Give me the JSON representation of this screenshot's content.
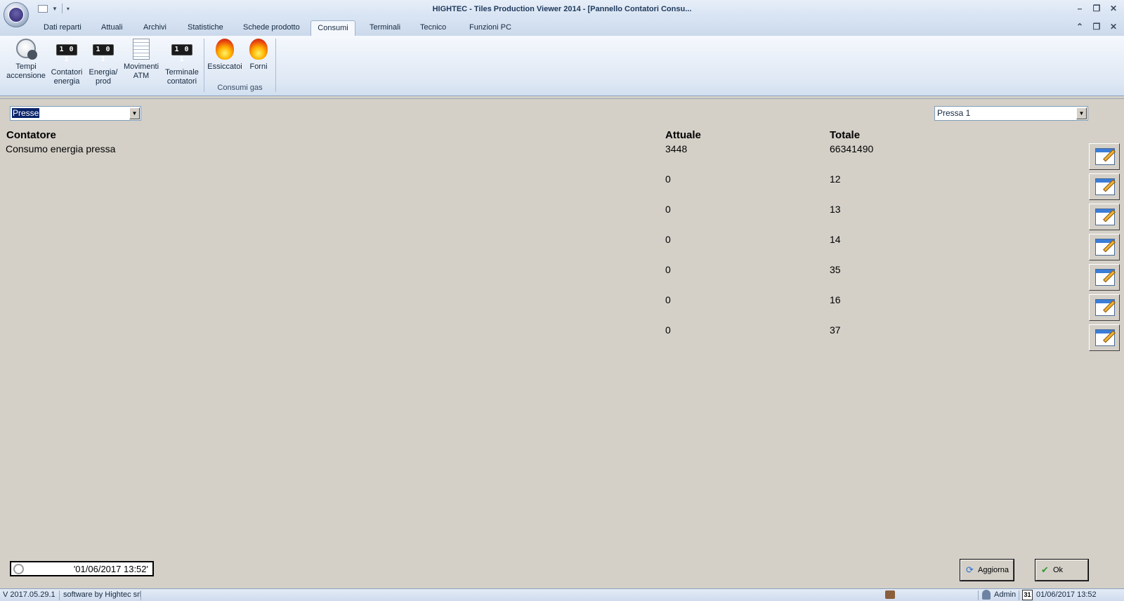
{
  "window": {
    "title": "HIGHTEC - Tiles Production Viewer 2014 - [Pannello Contatori Consu..."
  },
  "tabs": [
    {
      "label": "Dati reparti"
    },
    {
      "label": "Attuali"
    },
    {
      "label": "Archivi"
    },
    {
      "label": "Statistiche"
    },
    {
      "label": "Schede prodotto"
    },
    {
      "label": "Consumi"
    },
    {
      "label": "Terminali"
    },
    {
      "label": "Tecnico"
    },
    {
      "label": "Funzioni PC"
    }
  ],
  "active_tab": "Consumi",
  "ribbon": {
    "buttons": [
      {
        "label1": "Tempi",
        "label2": "accensione",
        "icon": "clock-icon"
      },
      {
        "label1": "Contatori",
        "label2": "energia",
        "icon": "counter-icon"
      },
      {
        "label1": "Energia/",
        "label2": "prod",
        "icon": "counter-icon"
      },
      {
        "label1": "Movimenti",
        "label2": "ATM",
        "icon": "sheet-icon"
      },
      {
        "label1": "Terminale",
        "label2": "contatori",
        "icon": "counter-icon"
      },
      {
        "label1": "Essiccatoi",
        "label2": "",
        "icon": "flame-icon"
      },
      {
        "label1": "Forni",
        "label2": "",
        "icon": "flame-icon"
      }
    ],
    "counter_glyph": "1 0 1",
    "group_label": "Consumi gas"
  },
  "filters": {
    "left_combo": "Presse",
    "right_combo": "Pressa 1"
  },
  "table": {
    "headers": {
      "contatore": "Contatore",
      "attuale": "Attuale",
      "totale": "Totale"
    },
    "rows": [
      {
        "contatore": "Consumo energia pressa",
        "attuale": "3448",
        "totale": "66341490"
      },
      {
        "contatore": "",
        "attuale": "0",
        "totale": "12"
      },
      {
        "contatore": "",
        "attuale": "0",
        "totale": "13"
      },
      {
        "contatore": "",
        "attuale": "0",
        "totale": "14"
      },
      {
        "contatore": "",
        "attuale": "0",
        "totale": "35"
      },
      {
        "contatore": "",
        "attuale": "0",
        "totale": "16"
      },
      {
        "contatore": "",
        "attuale": "0",
        "totale": "37"
      }
    ]
  },
  "footer": {
    "datetime_field": "'01/06/2017 13:52'",
    "refresh_label": "Aggiorna",
    "ok_label": "Ok"
  },
  "statusbar": {
    "version": "V 2017.05.29.1",
    "credits": "software by Hightec srl",
    "user": "Admin",
    "calendar_day": "31",
    "datetime": "01/06/2017 13:52"
  }
}
